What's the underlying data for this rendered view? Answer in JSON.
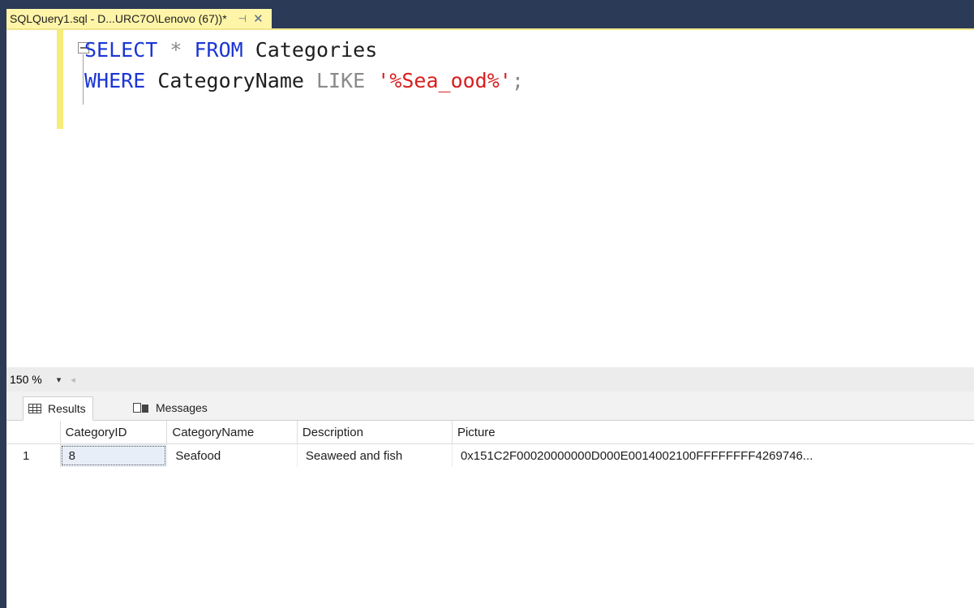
{
  "document_tab": {
    "title": "SQLQuery1.sql - D...URC7O\\Lenovo (67))*",
    "pin_icon": "pin-icon",
    "close_icon": "close-icon"
  },
  "editor": {
    "line1": {
      "kw1": "SELECT",
      "op": " * ",
      "kw2": "FROM",
      "ident": " Categories"
    },
    "line2": {
      "kw1": "WHERE",
      "ident": " CategoryName ",
      "op": "LIKE",
      "space": " ",
      "str": "'%Sea_ood%'",
      "semi": ";"
    },
    "colors": {
      "keyword": "#1b36d4",
      "operator": "#8a8a8a",
      "string": "#d91e1e",
      "change_bar": "#f5ec79"
    }
  },
  "zoom": {
    "value": "150 %",
    "caret": "▾",
    "scroll_arrow": "◂"
  },
  "results": {
    "tabs": [
      {
        "label": "Results",
        "icon": "grid-icon",
        "active": true
      },
      {
        "label": "Messages",
        "icon": "messages-icon",
        "active": false
      }
    ],
    "columns": [
      "CategoryID",
      "CategoryName",
      "Description",
      "Picture"
    ],
    "rows": [
      {
        "num": "1",
        "cells": [
          "8",
          "Seafood",
          "Seaweed and fish",
          "0x151C2F00020000000D000E0014002100FFFFFFFF4269746..."
        ]
      }
    ]
  }
}
